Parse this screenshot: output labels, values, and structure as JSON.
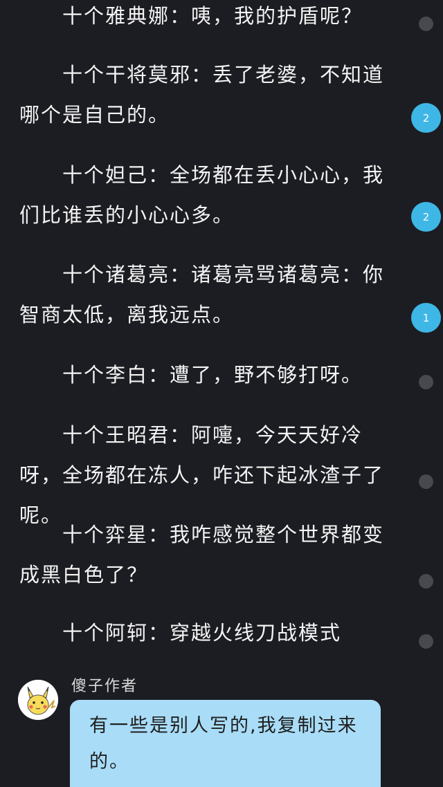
{
  "paragraphs": [
    {
      "text": "十个雅典娜：咦，我的护盾呢？",
      "comment_count": null
    },
    {
      "text": "十个干将莫邪：丢了老婆，不知道哪个是自己的。",
      "comment_count": "2"
    },
    {
      "text": "十个妲己：全场都在丢小心心，我们比谁丢的小心心多。",
      "comment_count": "2"
    },
    {
      "text": "十个诸葛亮：诸葛亮骂诸葛亮：你智商太低，离我远点。",
      "comment_count": "1"
    },
    {
      "text": "十个李白：遭了，野不够打呀。",
      "comment_count": null
    },
    {
      "text": "十个王昭君：阿嚏，今天天好冷呀，全场都在冻人，咋还下起冰渣子了呢。",
      "comment_count": null
    },
    {
      "text": "十个弈星：我咋感觉整个世界都变成黑白色了？",
      "comment_count": null
    },
    {
      "text": "十个阿轲：穿越火线刀战模式",
      "comment_count": null
    }
  ],
  "author_comment": {
    "author": "傻子作者",
    "text": "有一些是别人写的,我复制过来的。",
    "avatar_icon": "pikachu-avatar-icon"
  },
  "colors": {
    "background": "#1c1d22",
    "badge": "#3eb7e6",
    "marker": "#47494f",
    "bubble": "#a9dcf7"
  }
}
